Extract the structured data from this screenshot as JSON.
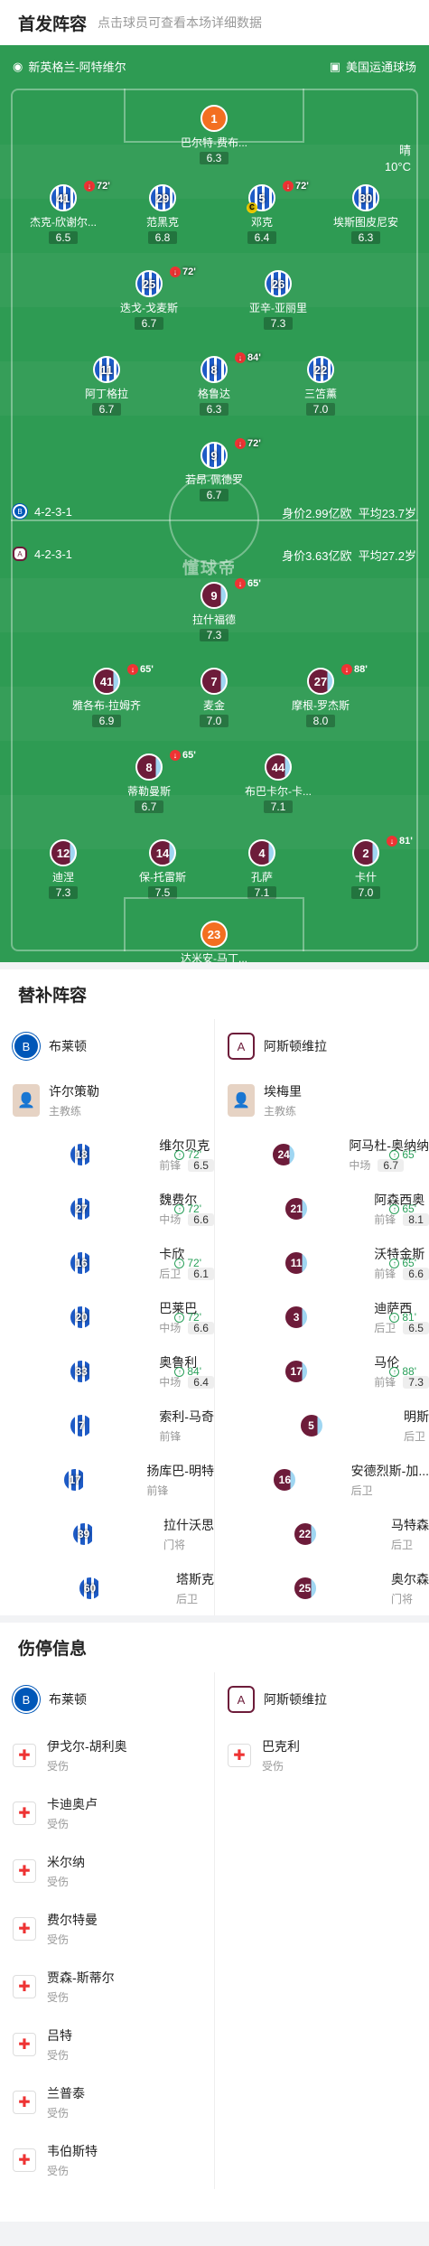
{
  "header": {
    "title": "首发阵容",
    "hint": "点击球员可查看本场详细数据"
  },
  "teams": {
    "home": "新英格兰-阿特维尔",
    "away": "美国运通球场"
  },
  "weather": {
    "cond": "晴",
    "temp": "10°C"
  },
  "home": {
    "formation": "4-2-3-1",
    "value": "身价2.99亿欧",
    "age": "平均23.7岁"
  },
  "away": {
    "formation": "4-2-3-1",
    "value": "身价3.63亿欧",
    "age": "平均27.2岁"
  },
  "brand": "懂球帝",
  "lineup": [
    {
      "no": "1",
      "name": "巴尔特-费布...",
      "rt": "6.3",
      "kit": "gk"
    },
    {
      "no": "41",
      "name": "杰克-欣谢尔...",
      "rt": "6.5",
      "kit": "bha",
      "sub": "72'"
    },
    {
      "no": "29",
      "name": "范黑克",
      "rt": "6.8",
      "kit": "bha"
    },
    {
      "no": "5",
      "name": "邓克",
      "rt": "6.4",
      "kit": "bha",
      "sub": "72'",
      "cap": "C"
    },
    {
      "no": "30",
      "name": "埃斯图皮尼安",
      "rt": "6.3",
      "kit": "bha"
    },
    {
      "no": "25",
      "name": "迭戈-戈麦斯",
      "rt": "6.7",
      "kit": "bha",
      "sub": "72'"
    },
    {
      "no": "26",
      "name": "亚辛-亚丽里",
      "rt": "7.3",
      "kit": "bha"
    },
    {
      "no": "11",
      "name": "阿丁格拉",
      "rt": "6.7",
      "kit": "bha"
    },
    {
      "no": "8",
      "name": "格鲁达",
      "rt": "6.3",
      "kit": "bha",
      "sub": "84'"
    },
    {
      "no": "22",
      "name": "三笘薰",
      "rt": "7.0",
      "kit": "bha"
    },
    {
      "no": "9",
      "name": "若昂-佩德罗",
      "rt": "6.7",
      "kit": "bha",
      "sub": "72'"
    },
    {
      "no": "9",
      "name": "拉什福德",
      "rt": "7.3",
      "kit": "avl",
      "sub": "65'"
    },
    {
      "no": "41",
      "name": "雅各布-拉姆齐",
      "rt": "6.9",
      "kit": "avl",
      "sub": "65'"
    },
    {
      "no": "7",
      "name": "麦金",
      "rt": "7.0",
      "kit": "avl"
    },
    {
      "no": "27",
      "name": "摩根-罗杰斯",
      "rt": "8.0",
      "kit": "avl",
      "sub": "88'"
    },
    {
      "no": "8",
      "name": "蒂勒曼斯",
      "rt": "6.7",
      "kit": "avl",
      "sub": "65'"
    },
    {
      "no": "44",
      "name": "布巴卡尔-卡...",
      "rt": "7.1",
      "kit": "avl"
    },
    {
      "no": "12",
      "name": "迪涅",
      "rt": "7.3",
      "kit": "avl"
    },
    {
      "no": "14",
      "name": "保-托雷斯",
      "rt": "7.5",
      "kit": "avl"
    },
    {
      "no": "4",
      "name": "孔萨",
      "rt": "7.1",
      "kit": "avl"
    },
    {
      "no": "2",
      "name": "卡什",
      "rt": "7.0",
      "kit": "avl",
      "sub": "81'"
    },
    {
      "no": "23",
      "name": "达米安-马丁...",
      "rt": "7.5",
      "kit": "gk"
    }
  ],
  "subs": {
    "title": "替补阵容",
    "home_team": "布莱顿",
    "away_team": "阿斯顿维拉",
    "home_coach": "许尔策勒",
    "away_coach": "埃梅里",
    "coach_label": "主教练",
    "home": [
      {
        "no": "18",
        "name": "维尔贝克",
        "pos": "前锋",
        "rt": "6.5",
        "ev": "72'"
      },
      {
        "no": "27",
        "name": "魏费尔",
        "pos": "中场",
        "rt": "6.6",
        "ev": "72'"
      },
      {
        "no": "16",
        "name": "卡欣",
        "pos": "后卫",
        "rt": "6.1",
        "ev": "72'"
      },
      {
        "no": "20",
        "name": "巴莱巴",
        "pos": "中场",
        "rt": "6.6",
        "ev": "72'"
      },
      {
        "no": "33",
        "name": "奥鲁利",
        "pos": "中场",
        "rt": "6.4",
        "ev": "84'"
      },
      {
        "no": "7",
        "name": "索利-马奇",
        "pos": "前锋",
        "rt": "",
        "ev": ""
      },
      {
        "no": "17",
        "name": "扬库巴-明特",
        "pos": "前锋",
        "rt": "",
        "ev": ""
      },
      {
        "no": "39",
        "name": "拉什沃思",
        "pos": "门将",
        "rt": "",
        "ev": ""
      },
      {
        "no": "60",
        "name": "塔斯克",
        "pos": "后卫",
        "rt": "",
        "ev": ""
      }
    ],
    "away": [
      {
        "no": "24",
        "name": "阿马杜-奥纳纳",
        "pos": "中场",
        "rt": "6.7",
        "ev": "65'"
      },
      {
        "no": "21",
        "name": "阿森西奥",
        "pos": "前锋",
        "rt": "8.1",
        "ev": "65'"
      },
      {
        "no": "11",
        "name": "沃特金斯",
        "pos": "前锋",
        "rt": "6.6",
        "ev": "65'"
      },
      {
        "no": "3",
        "name": "迪萨西",
        "pos": "后卫",
        "rt": "6.5",
        "ev": "81'"
      },
      {
        "no": "17",
        "name": "马伦",
        "pos": "前锋",
        "rt": "7.3",
        "ev": "88'"
      },
      {
        "no": "5",
        "name": "明斯",
        "pos": "后卫",
        "rt": "",
        "ev": ""
      },
      {
        "no": "16",
        "name": "安德烈斯-加...",
        "pos": "后卫",
        "rt": "",
        "ev": ""
      },
      {
        "no": "22",
        "name": "马特森",
        "pos": "后卫",
        "rt": "",
        "ev": ""
      },
      {
        "no": "25",
        "name": "奥尔森",
        "pos": "门将",
        "rt": "",
        "ev": ""
      }
    ]
  },
  "injury": {
    "title": "伤停信息",
    "home_team": "布莱顿",
    "away_team": "阿斯顿维拉",
    "label": "受伤",
    "home": [
      "伊戈尔-胡利奥",
      "卡迪奥卢",
      "米尔纳",
      "费尔特曼",
      "贾森-斯蒂尔",
      "吕特",
      "兰普泰",
      "韦伯斯特"
    ],
    "away": [
      "巴克利"
    ]
  }
}
